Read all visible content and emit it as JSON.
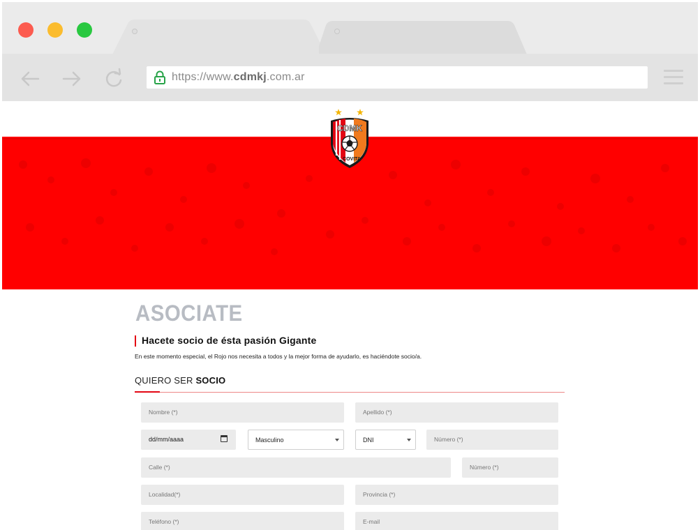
{
  "browser": {
    "url_prefix": "https://www.",
    "url_domain": "cdmkj",
    "url_suffix": ".com.ar"
  },
  "colors": {
    "hero_red": "#ff0000",
    "accent_red": "#e30613",
    "title_gray": "#b8bcc3",
    "field_bg": "#ebebeb"
  },
  "hero": {
    "logo_icon": "club-crest"
  },
  "page": {
    "title": "ASOCIATE",
    "subtitle": "Hacete socio de ésta pasión Gigante",
    "intro": "En este momento especial, el Rojo nos necesita a todos y la mejor forma de ayudarlo, es haciéndote socio/a.",
    "section_prefix": "QUIERO SER ",
    "section_emphasis": "SOCIO"
  },
  "form": {
    "nombre_placeholder": "Nombre (*)",
    "apellido_placeholder": "Apellido (*)",
    "fecha_value": "dd/mm/aaaa",
    "sexo_value": "Masculino",
    "doc_tipo_value": "DNI",
    "doc_numero_placeholder": "Número (*)",
    "calle_placeholder": "Calle (*)",
    "calle_numero_placeholder": "Número (*)",
    "localidad_placeholder": "Localidad(*)",
    "provincia_placeholder": "Provincia (*)",
    "telefono_placeholder": "Teléfono (*)",
    "email_placeholder": "E-mail"
  }
}
